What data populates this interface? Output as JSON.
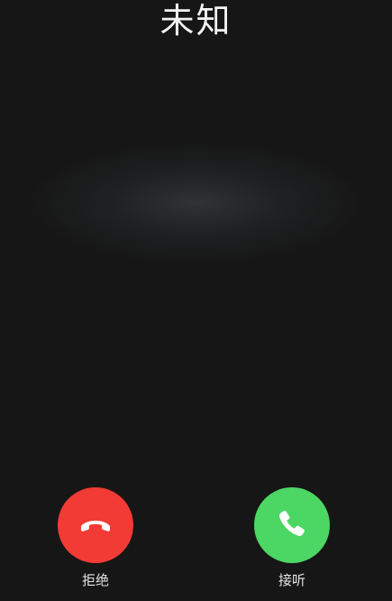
{
  "call": {
    "caller_name": "未知"
  },
  "actions": {
    "decline_label": "拒绝",
    "accept_label": "接听"
  },
  "colors": {
    "background": "#161616",
    "decline": "#f23b35",
    "accept": "#4cd663",
    "icon": "#ffffff"
  },
  "icons": {
    "decline": "phone-hangup-icon",
    "accept": "phone-icon"
  }
}
